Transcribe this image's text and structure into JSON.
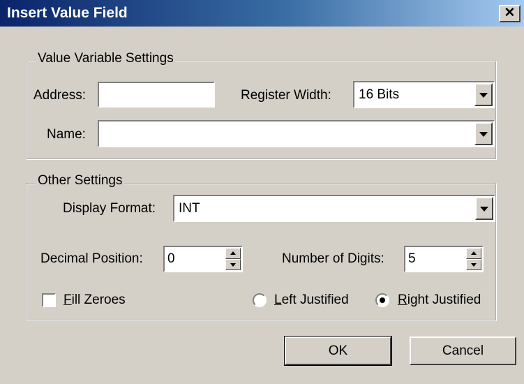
{
  "window": {
    "title": "Insert Value Field",
    "close_glyph": "✕"
  },
  "value_variable_settings": {
    "legend": "Value Variable Settings",
    "address_label": "Address:",
    "address_value": "",
    "register_width_label": "Register Width:",
    "register_width_value": "16 Bits",
    "name_label": "Name:",
    "name_value": ""
  },
  "other_settings": {
    "legend": "Other Settings",
    "display_format_label": "Display Format:",
    "display_format_value": "INT",
    "decimal_position_label": "Decimal Position:",
    "decimal_position_value": "0",
    "number_of_digits_label": "Number of Digits:",
    "number_of_digits_value": "5",
    "fill_zeroes": {
      "accel": "F",
      "rest": "ill Zeroes",
      "checked": false
    },
    "left_justified": {
      "accel": "L",
      "rest": "eft Justified",
      "selected": false
    },
    "right_justified": {
      "accel": "R",
      "rest": "ight Justified",
      "selected": true
    }
  },
  "buttons": {
    "ok": "OK",
    "cancel": "Cancel"
  },
  "colors": {
    "face": "#d4d0c8",
    "title_start": "#0a246a",
    "title_end": "#a6caf0"
  }
}
